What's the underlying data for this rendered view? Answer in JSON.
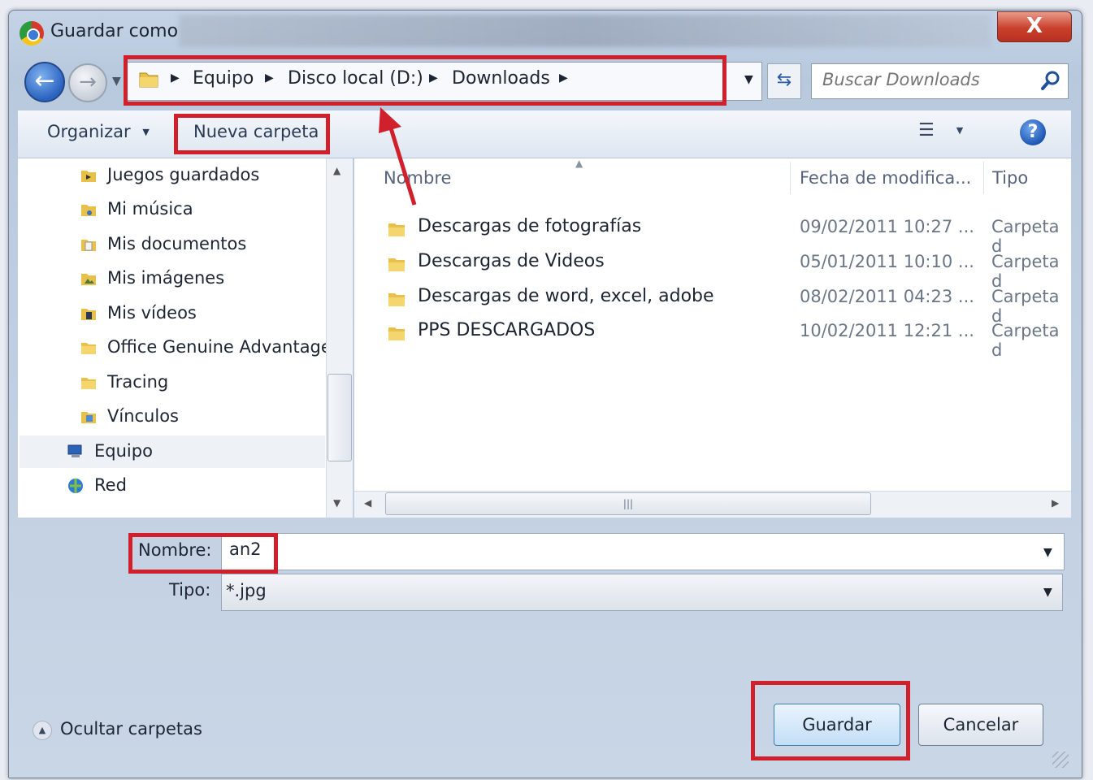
{
  "window": {
    "title": "Guardar como",
    "close_glyph": "X"
  },
  "address": {
    "crumbs": [
      "Equipo",
      "Disco local (D:)",
      "Downloads"
    ],
    "separator": "▶"
  },
  "search": {
    "placeholder": "Buscar Downloads"
  },
  "toolbar": {
    "organize_label": "Organizar",
    "new_folder_label": "Nueva carpeta",
    "help_glyph": "?"
  },
  "nav_pane": {
    "items": [
      {
        "label": "Juegos guardados",
        "icon": "saved-games-icon"
      },
      {
        "label": "Mi música",
        "icon": "music-icon"
      },
      {
        "label": "Mis documentos",
        "icon": "documents-icon"
      },
      {
        "label": "Mis imágenes",
        "icon": "pictures-icon"
      },
      {
        "label": "Mis vídeos",
        "icon": "videos-icon"
      },
      {
        "label": "Office Genuine Advantage",
        "icon": "folder-icon"
      },
      {
        "label": "Tracing",
        "icon": "folder-icon"
      },
      {
        "label": "Vínculos",
        "icon": "links-icon"
      },
      {
        "label": "Equipo",
        "icon": "computer-icon"
      },
      {
        "label": "Red",
        "icon": "network-icon"
      }
    ]
  },
  "file_list": {
    "columns": [
      "Nombre",
      "Fecha de modifica...",
      "Tipo"
    ],
    "rows": [
      {
        "name": "Descargas de fotografías",
        "date": "09/02/2011 10:27 ...",
        "type": "Carpeta d"
      },
      {
        "name": "Descargas de Videos",
        "date": "05/01/2011 10:10 ...",
        "type": "Carpeta d"
      },
      {
        "name": "Descargas de word, excel, adobe",
        "date": "08/02/2011 04:23 ...",
        "type": "Carpeta d"
      },
      {
        "name": "PPS DESCARGADOS",
        "date": "10/02/2011 12:21 ...",
        "type": "Carpeta d"
      }
    ]
  },
  "form": {
    "name_label": "Nombre:",
    "name_value": "an2",
    "type_label": "Tipo:",
    "type_value": "*.jpg"
  },
  "footer": {
    "hide_folders_label": "Ocultar carpetas",
    "save_label": "Guardar",
    "cancel_label": "Cancelar"
  },
  "colors": {
    "annotation_red": "#d0202c",
    "folder_yellow": "#e8c04a",
    "accent_blue": "#2a62bf"
  }
}
